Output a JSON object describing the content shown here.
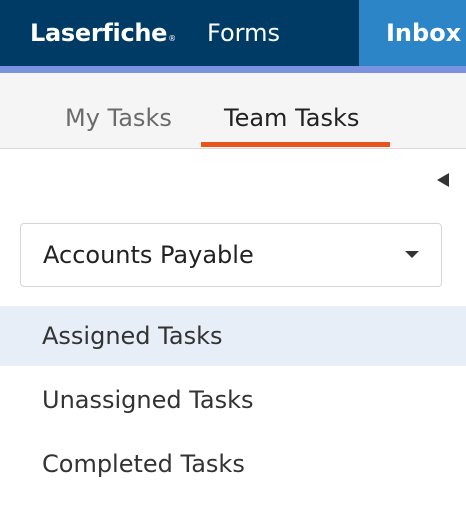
{
  "header": {
    "logo_text": "Laserfiche",
    "logo_mark": "®",
    "product": "Forms",
    "inbox_label": "Inbox",
    "colors": {
      "header_bg": "#003b66",
      "inbox_bg": "#2c85c7",
      "accent_bar": "#7b92e0"
    }
  },
  "tabs": {
    "my_tasks": "My Tasks",
    "team_tasks": "Team Tasks",
    "active": "Team Tasks",
    "active_color": "#e8541c"
  },
  "panel": {
    "collapse_icon": "caret-left-icon",
    "team_select": {
      "value": "Accounts Payable",
      "icon": "caret-down-icon"
    },
    "items": [
      {
        "label": "Assigned Tasks",
        "selected": true
      },
      {
        "label": "Unassigned Tasks",
        "selected": false
      },
      {
        "label": "Completed Tasks",
        "selected": false
      }
    ]
  }
}
